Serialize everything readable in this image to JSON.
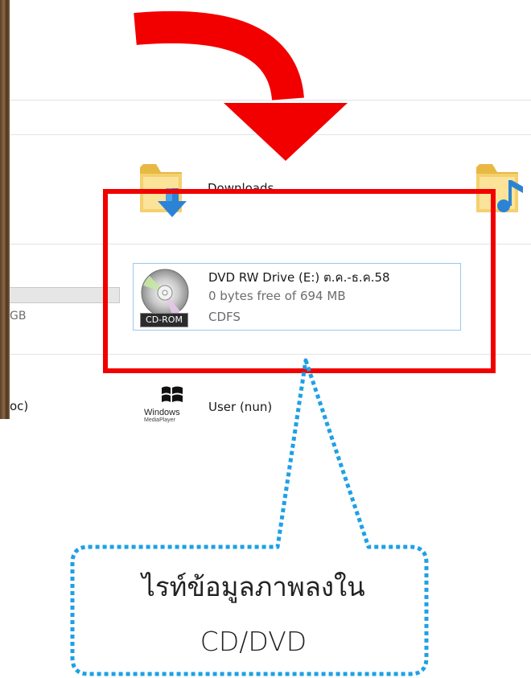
{
  "explorer": {
    "folders": [
      {
        "name": "Downloads",
        "icon": "downloads-folder-icon"
      },
      {
        "name": "",
        "icon": "music-folder-icon"
      }
    ],
    "drive": {
      "title": "DVD RW Drive (E:) ต.ค.-ธ.ค.58",
      "free_space": "0 bytes free of 694 MB",
      "filesystem": "CDFS",
      "badge": "CD-ROM",
      "icon": "cd-rom-icon"
    },
    "stub_left_size": "GB",
    "stub_left_label": "oc)",
    "network_item": {
      "name": "User (nun)",
      "logo_text": "Windows",
      "logo_sub": "MediaPlayer",
      "icon": "windows-media-player-icon"
    }
  },
  "annotations": {
    "arrow_color": "#f20000",
    "highlight_color": "#f20000",
    "callout_border_color": "#1ea0e6",
    "callout_line1": "ไรท์ข้อมูลภาพลงใน",
    "callout_line2": "CD/DVD"
  }
}
